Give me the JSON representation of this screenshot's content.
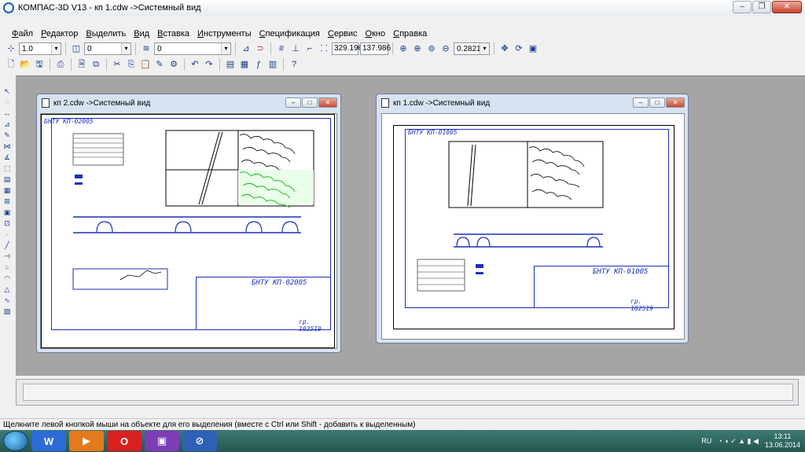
{
  "window": {
    "title": "КОМПАС-3D V13 - кп 1.cdw ->Системный вид"
  },
  "menu": [
    "Файл",
    "Редактор",
    "Выделить",
    "Вид",
    "Вставка",
    "Инструменты",
    "Спецификация",
    "Сервис",
    "Окно",
    "Справка"
  ],
  "toolbar": {
    "scale_value": "1.0",
    "layer_value": "0",
    "style_value": "0",
    "coord_x": "329.196",
    "coord_y": "137.986",
    "zoom_value": "0.2821"
  },
  "docs": [
    {
      "title": "кп 2.cdw ->Системный вид",
      "stamp_code": "БНТУ КП-02005",
      "corner_code": "БНТУ КП-02005",
      "group": "гр. 102519"
    },
    {
      "title": "кп 1.cdw ->Системный вид",
      "stamp_code": "БНТУ КП-01005",
      "corner_code": "БНТУ КП-01005",
      "group": "гр. 102519"
    }
  ],
  "status": {
    "hint": "Щелкните левой кнопкой мыши на объекте для его выделения (вместе с Ctrl или Shift - добавить к выделенным)"
  },
  "taskbar": {
    "lang": "RU",
    "time": "13:11",
    "date": "13.06.2014"
  },
  "icons": [
    "app-icon",
    "save-icon",
    "open-icon",
    "print-icon",
    "zoom-icon",
    "pan-icon"
  ],
  "colors": {
    "frame_blue": "#1d2fbf",
    "workspace": "#a5a5a5",
    "taskbar": "#2f6a62"
  }
}
